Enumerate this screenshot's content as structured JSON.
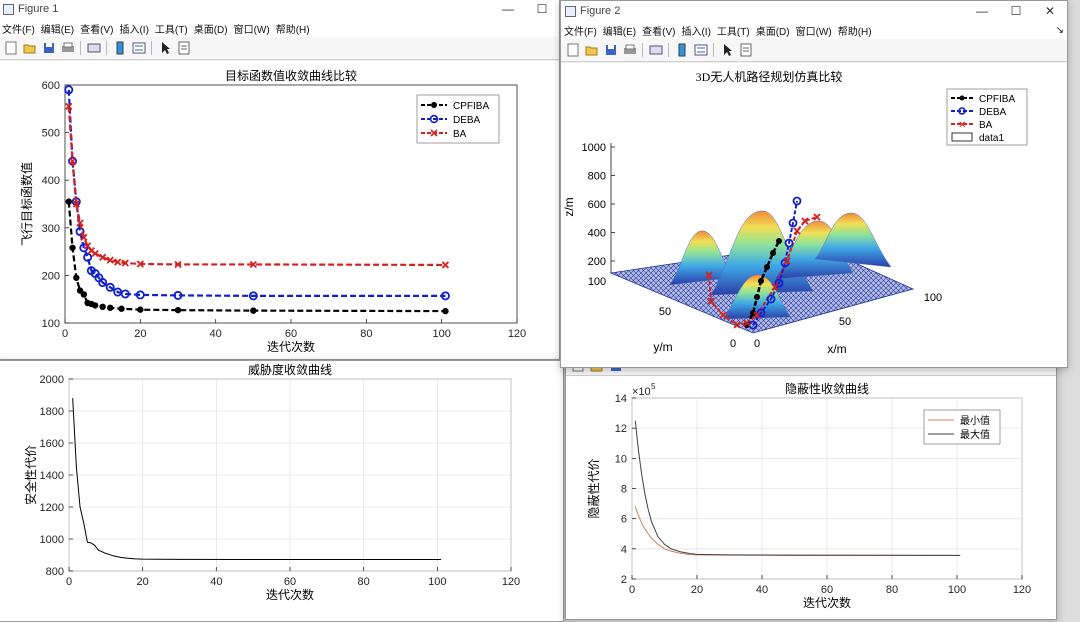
{
  "windows": {
    "figure1": {
      "title": "Figure 1"
    },
    "figure2": {
      "title": "Figure 2"
    }
  },
  "menu": [
    "文件(F)",
    "编辑(E)",
    "查看(V)",
    "插入(I)",
    "工具(T)",
    "桌面(D)",
    "窗口(W)",
    "帮助(H)"
  ],
  "colors": {
    "cpfiba": "#000000",
    "deba": "#0f1fd0",
    "ba": "#d42020",
    "min": "#d08060",
    "max": "#404040"
  },
  "chart_data": [
    {
      "id": "obj",
      "type": "line",
      "title": "目标函数值收敛曲线比较",
      "xlabel": "迭代次数",
      "ylabel": "飞行目标函数值",
      "xlim": [
        0,
        120
      ],
      "ylim": [
        100,
        600
      ],
      "xticks": [
        0,
        20,
        40,
        60,
        80,
        100,
        120
      ],
      "yticks": [
        100,
        200,
        300,
        400,
        500,
        600
      ],
      "legend": "top-right",
      "series": [
        {
          "name": "CPFIBA",
          "color": "#000000",
          "marker": "dot",
          "x": [
            1,
            2,
            3,
            4,
            5,
            6,
            7,
            8,
            10,
            12,
            15,
            20,
            30,
            50,
            101
          ],
          "y": [
            355,
            258,
            195,
            168,
            160,
            142,
            140,
            137,
            134,
            132,
            130,
            128,
            127,
            126,
            125
          ]
        },
        {
          "name": "DEBA",
          "color": "#0f1fd0",
          "marker": "circle",
          "x": [
            1,
            2,
            3,
            4,
            5,
            6,
            7,
            8,
            9,
            10,
            12,
            14,
            16,
            20,
            30,
            50,
            101
          ],
          "y": [
            590,
            440,
            355,
            292,
            258,
            238,
            210,
            204,
            195,
            185,
            175,
            165,
            161,
            159,
            158,
            157,
            157
          ]
        },
        {
          "name": "BA",
          "color": "#d42020",
          "marker": "x",
          "x": [
            1,
            2,
            3,
            4,
            5,
            6,
            7,
            8,
            10,
            12,
            14,
            16,
            20,
            30,
            50,
            101
          ],
          "y": [
            555,
            440,
            350,
            310,
            280,
            262,
            252,
            246,
            238,
            232,
            228,
            226,
            224,
            223,
            223,
            222
          ]
        }
      ]
    },
    {
      "id": "threat",
      "type": "line",
      "title": "威胁度收敛曲线",
      "xlabel": "迭代次数",
      "ylabel": "安全性代价",
      "xlim": [
        0,
        120
      ],
      "ylim": [
        800,
        2000
      ],
      "xticks": [
        0,
        20,
        40,
        60,
        80,
        100,
        120
      ],
      "yticks": [
        800,
        1000,
        1200,
        1400,
        1600,
        1800,
        2000
      ],
      "grid": true,
      "series": [
        {
          "color": "#000000",
          "x": [
            1,
            2,
            3,
            4,
            5,
            6,
            7,
            8,
            10,
            12,
            14,
            16,
            18,
            20,
            30,
            50,
            101
          ],
          "y": [
            1880,
            1450,
            1200,
            1100,
            980,
            975,
            960,
            930,
            910,
            895,
            885,
            880,
            876,
            874,
            873,
            872,
            872
          ]
        }
      ]
    },
    {
      "id": "stealth",
      "type": "line",
      "title": "隐蔽性收敛曲线",
      "xlabel": "迭代次数",
      "ylabel": "隐蔽性代价",
      "y_multiplier": "×10",
      "y_exponent": "5",
      "xlim": [
        0,
        120
      ],
      "ylim": [
        2,
        14
      ],
      "xticks": [
        0,
        20,
        40,
        60,
        80,
        100,
        120
      ],
      "yticks": [
        2,
        4,
        6,
        8,
        10,
        12,
        14
      ],
      "grid": true,
      "legend": "top-right",
      "series": [
        {
          "name": "最小值",
          "color": "#d08060",
          "x": [
            1,
            2,
            3,
            4,
            5,
            6,
            8,
            10,
            12,
            15,
            18,
            20,
            30,
            50,
            101
          ],
          "y": [
            6.8,
            6.2,
            5.7,
            5.3,
            5.0,
            4.7,
            4.3,
            4.0,
            3.85,
            3.7,
            3.62,
            3.6,
            3.58,
            3.57,
            3.56
          ]
        },
        {
          "name": "最大值",
          "color": "#404040",
          "x": [
            1,
            2,
            3,
            4,
            5,
            6,
            8,
            10,
            12,
            15,
            18,
            20,
            30,
            50,
            101
          ],
          "y": [
            12.5,
            10.5,
            8.9,
            7.6,
            6.6,
            5.8,
            4.8,
            4.3,
            4.0,
            3.8,
            3.68,
            3.63,
            3.6,
            3.58,
            3.57
          ]
        }
      ]
    },
    {
      "id": "path3d",
      "type": "scatter",
      "title": "3D无人机路径规划仿真比较",
      "xlabel": "x/m",
      "ylabel": "y/m",
      "zlabel": "z/m",
      "zticks": [
        200,
        400,
        600,
        800,
        1000
      ],
      "xticks": [
        0,
        50,
        100
      ],
      "yticks": [
        0,
        50,
        100
      ],
      "legend": "top-right",
      "series": [
        {
          "name": "CPFIBA",
          "color": "#000000",
          "marker": "dot"
        },
        {
          "name": "DEBA",
          "color": "#0f1fd0",
          "marker": "circle"
        },
        {
          "name": "BA",
          "color": "#d42020",
          "marker": "x"
        },
        {
          "name": "data1",
          "color": "#ffffff",
          "marker": "surface"
        }
      ]
    }
  ]
}
